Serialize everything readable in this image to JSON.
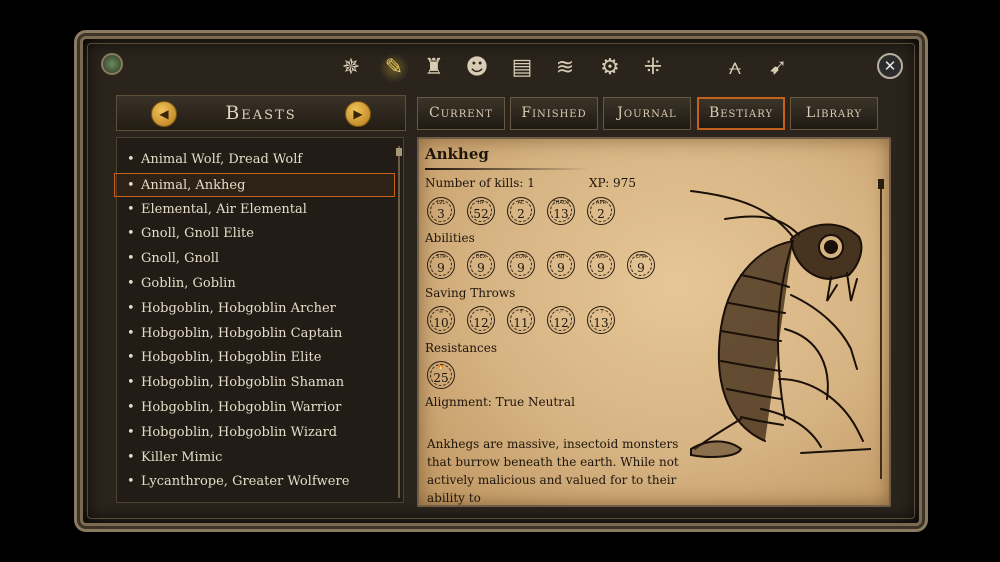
{
  "top_icons": [
    {
      "name": "map-compass-icon",
      "glyph": "✵",
      "active": false
    },
    {
      "name": "quill-journal-icon",
      "glyph": "✎",
      "active": true
    },
    {
      "name": "armor-icon",
      "glyph": "♜",
      "active": false
    },
    {
      "name": "head-profile-icon",
      "glyph": "☻",
      "active": false
    },
    {
      "name": "spellbook-icon",
      "glyph": "▤",
      "active": false
    },
    {
      "name": "scroll-icon",
      "glyph": "≋",
      "active": false
    },
    {
      "name": "gear-icon",
      "glyph": "⚙",
      "active": false
    },
    {
      "name": "party-formation-icon",
      "glyph": "⁜",
      "active": false
    },
    {
      "name": "eye-rest-icon",
      "glyph": "⩜",
      "active": false
    },
    {
      "name": "sword-quill-icon",
      "glyph": "➹",
      "active": false
    }
  ],
  "close_glyph": "✕",
  "left_panel": {
    "title": "Beasts",
    "prev_glyph": "◀",
    "next_glyph": "▶",
    "bullet": "•",
    "items": [
      "Animal Wolf, Dread Wolf",
      "Animal, Ankheg",
      "Elemental, Air Elemental",
      "Gnoll, Gnoll Elite",
      "Gnoll, Gnoll",
      "Goblin, Goblin",
      "Hobgoblin, Hobgoblin Archer",
      "Hobgoblin, Hobgoblin Captain",
      "Hobgoblin, Hobgoblin Elite",
      "Hobgoblin, Hobgoblin Shaman",
      "Hobgoblin, Hobgoblin Warrior",
      "Hobgoblin, Hobgoblin Wizard",
      "Killer Mimic",
      "Lycanthrope, Greater Wolfwere"
    ],
    "selected_index": 1
  },
  "tabs": [
    {
      "label": "Current",
      "active": false
    },
    {
      "label": "Finished",
      "active": false
    },
    {
      "label": "Journal",
      "active": false
    },
    {
      "label": "Bestiary",
      "active": true
    },
    {
      "label": "Library",
      "active": false
    }
  ],
  "entry": {
    "name": "Ankheg",
    "kills_text": "Number of kills: 1",
    "xp_text": "XP: 975",
    "stats": [
      {
        "label": "LVL",
        "value": "3"
      },
      {
        "label": "HP",
        "value": "52"
      },
      {
        "label": "AC",
        "value": "2"
      },
      {
        "label": "THAC0",
        "value": "13"
      },
      {
        "label": "APR",
        "value": "2"
      }
    ],
    "abilities_heading": "Abilities",
    "abilities": [
      {
        "label": "STR",
        "value": "9"
      },
      {
        "label": "DEX",
        "value": "9"
      },
      {
        "label": "CON",
        "value": "9"
      },
      {
        "label": "INT",
        "value": "9"
      },
      {
        "label": "WIS",
        "value": "9"
      },
      {
        "label": "CHA",
        "value": "9"
      }
    ],
    "saves_heading": "Saving Throws",
    "saves": [
      {
        "label": "☠",
        "value": "10"
      },
      {
        "label": "⚚",
        "value": "12"
      },
      {
        "label": "✝",
        "value": "11"
      },
      {
        "label": "☄",
        "value": "12"
      },
      {
        "label": "☽",
        "value": "13"
      }
    ],
    "resist_heading": "Resistances",
    "resists": [
      {
        "label": "🔥",
        "value": "25"
      }
    ],
    "alignment_text": "Alignment: True Neutral",
    "description": "Ankhegs are massive, insectoid monsters that burrow beneath the earth. While not actively malicious and valued for to their ability to"
  },
  "colors": {
    "accent_selected": "#c4621c",
    "arrow_gold": "#e0a43a",
    "parchment": "#d6b382",
    "ink": "#1e150c"
  }
}
